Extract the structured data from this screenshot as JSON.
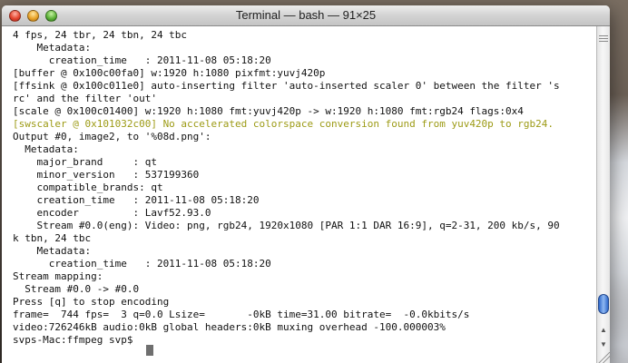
{
  "window": {
    "title": "Terminal — bash — 91×25"
  },
  "terminal": {
    "lines": [
      {
        "text": "4 fps, 24 tbr, 24 tbn, 24 tbc",
        "style": "normal"
      },
      {
        "text": "    Metadata:",
        "style": "normal"
      },
      {
        "text": "      creation_time   : 2011-11-08 05:18:20",
        "style": "normal"
      },
      {
        "text": "[buffer @ 0x100c00fa0] w:1920 h:1080 pixfmt:yuvj420p",
        "style": "normal"
      },
      {
        "text": "[ffsink @ 0x100c011e0] auto-inserting filter 'auto-inserted scaler 0' between the filter 's",
        "style": "normal"
      },
      {
        "text": "rc' and the filter 'out'",
        "style": "normal"
      },
      {
        "text": "[scale @ 0x100c01400] w:1920 h:1080 fmt:yuvj420p -> w:1920 h:1080 fmt:rgb24 flags:0x4",
        "style": "normal"
      },
      {
        "text": "[swscaler @ 0x101032c00] No accelerated colorspace conversion found from yuv420p to rgb24.",
        "style": "warn"
      },
      {
        "text": "Output #0, image2, to '%08d.png':",
        "style": "normal"
      },
      {
        "text": "  Metadata:",
        "style": "normal"
      },
      {
        "text": "    major_brand     : qt",
        "style": "normal"
      },
      {
        "text": "    minor_version   : 537199360",
        "style": "normal"
      },
      {
        "text": "    compatible_brands: qt",
        "style": "normal"
      },
      {
        "text": "    creation_time   : 2011-11-08 05:18:20",
        "style": "normal"
      },
      {
        "text": "    encoder         : Lavf52.93.0",
        "style": "normal"
      },
      {
        "text": "    Stream #0.0(eng): Video: png, rgb24, 1920x1080 [PAR 1:1 DAR 16:9], q=2-31, 200 kb/s, 90",
        "style": "normal"
      },
      {
        "text": "k tbn, 24 tbc",
        "style": "normal"
      },
      {
        "text": "    Metadata:",
        "style": "normal"
      },
      {
        "text": "      creation_time   : 2011-11-08 05:18:20",
        "style": "normal"
      },
      {
        "text": "Stream mapping:",
        "style": "normal"
      },
      {
        "text": "  Stream #0.0 -> #0.0",
        "style": "normal"
      },
      {
        "text": "Press [q] to stop encoding",
        "style": "normal"
      },
      {
        "text": "frame=  744 fps=  3 q=0.0 Lsize=       -0kB time=31.00 bitrate=  -0.0kbits/s",
        "style": "normal"
      },
      {
        "text": "video:726246kB audio:0kB global headers:0kB muxing overhead -100.000003%",
        "style": "normal"
      },
      {
        "text": "svps-Mac:ffmpeg svp$ ",
        "style": "normal"
      }
    ]
  },
  "icons": {
    "close": "close-button",
    "minimize": "minimize-button",
    "zoom": "zoom-button",
    "scroll_up": "arrow-up-icon",
    "scroll_down": "arrow-down-icon"
  },
  "colors": {
    "warn_text": "#9d9b16",
    "scroll_thumb": "#2e68c9"
  }
}
